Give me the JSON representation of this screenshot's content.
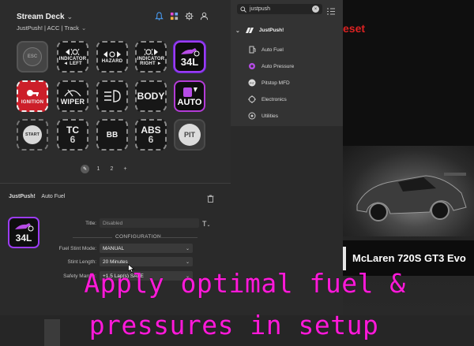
{
  "app": {
    "title": "Stream Deck",
    "profile": "JustPush! | ACC | Track"
  },
  "colors": {
    "accent_purple": "#9c3cf3",
    "caption_magenta": "#ff1ad9",
    "ignition_red": "#cc1f2a",
    "reset_red": "#d22222"
  },
  "keys": {
    "row1": [
      {
        "name": "esc-key",
        "label": "ESC"
      },
      {
        "name": "indicator-left-key",
        "label_top": "INDICATOR",
        "label_bottom": "◄ LEFT"
      },
      {
        "name": "hazard-key",
        "label": "HAZARD"
      },
      {
        "name": "indicator-right-key",
        "label_top": "INDICATOR",
        "label_bottom": "RIGHT ►"
      },
      {
        "name": "auto-fuel-key",
        "value": "34L"
      }
    ],
    "row2": [
      {
        "name": "ignition-key",
        "label": "IGNITION"
      },
      {
        "name": "wiper-key",
        "label": "WIPER"
      },
      {
        "name": "lights-key",
        "label": ""
      },
      {
        "name": "body-key",
        "label": "BODY"
      },
      {
        "name": "auto-pressure-key",
        "label": "AUTO"
      }
    ],
    "row3": [
      {
        "name": "start-key",
        "label": "START"
      },
      {
        "name": "tc-key",
        "label": "TC",
        "value": "6"
      },
      {
        "name": "bb-key",
        "label": "BB"
      },
      {
        "name": "abs-key",
        "label": "ABS",
        "value": "6"
      },
      {
        "name": "pit-key",
        "label": "PIT"
      }
    ]
  },
  "pager": {
    "page1": "1",
    "page2": "2",
    "add": "+"
  },
  "inspector": {
    "plugin": "JustPush!",
    "action": "Auto Fuel",
    "key_value": "34L",
    "title_label": "Title:",
    "title_value": "Disabled",
    "title_btn": "T",
    "section": "CONFIGURATION",
    "fields": [
      {
        "label": "Fuel Stint Mode:",
        "value": "MANUAL"
      },
      {
        "label": "Stint Length:",
        "value": "20 Minutes"
      },
      {
        "label": "Safety Margin:",
        "value": "+1.5 Lap(s) SAFE"
      }
    ]
  },
  "actions_panel": {
    "search_value": "justpush",
    "plugin_name": "JustPush!",
    "items": [
      {
        "name": "auto-fuel",
        "label": "Auto Fuel"
      },
      {
        "name": "auto-pressure",
        "label": "Auto Pressure"
      },
      {
        "name": "pitstop-mfd",
        "label": "Pitstop MFD"
      },
      {
        "name": "electronics",
        "label": "Electronics"
      },
      {
        "name": "utilities",
        "label": "Utilities"
      }
    ]
  },
  "game": {
    "reset_text": "eset",
    "car_name": "McLaren 720S GT3 Evo"
  },
  "caption": {
    "line1": "Apply optimal fuel &",
    "line2": "pressures in setup"
  }
}
